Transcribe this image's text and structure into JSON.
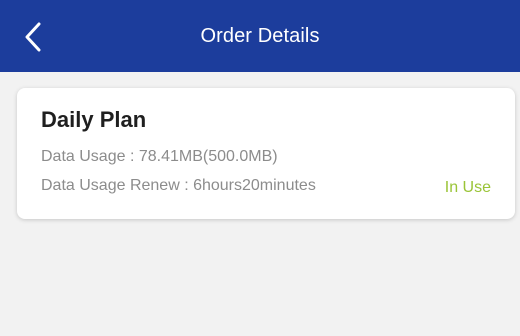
{
  "header": {
    "title": "Order Details",
    "back_icon": "chevron-left-icon"
  },
  "order": {
    "plan_name": "Daily Plan",
    "data_usage": "Data Usage : 78.41MB(500.0MB)",
    "data_usage_renew": "Data Usage Renew : 6hours20minutes",
    "status": "In Use"
  },
  "colors": {
    "header_bg": "#1c3d9c",
    "page_bg": "#f2f2f2",
    "status_green": "#9ac437",
    "secondary_text": "#8c8c8c"
  }
}
